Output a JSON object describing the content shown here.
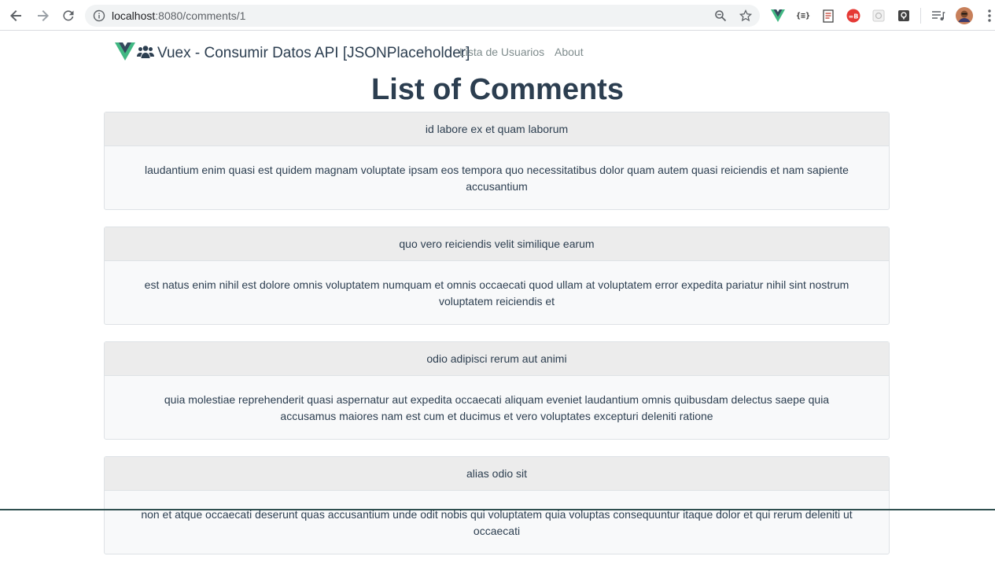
{
  "browser": {
    "url_host": "localhost",
    "url_rest": ":8080/comments/1"
  },
  "app": {
    "brand": "Vuex - Consumir Datos API [JSONPlaceholder]",
    "nav_links": [
      "Lista de Usuarios",
      "About"
    ],
    "title": "List of Comments"
  },
  "comments": [
    {
      "name": "id labore ex et quam laborum",
      "body": "laudantium enim quasi est quidem magnam voluptate ipsam eos tempora quo necessitatibus dolor quam autem quasi reiciendis et nam sapiente accusantium"
    },
    {
      "name": "quo vero reiciendis velit similique earum",
      "body": "est natus enim nihil est dolore omnis voluptatem numquam et omnis occaecati quod ullam at voluptatem error expedita pariatur nihil sint nostrum voluptatem reiciendis et"
    },
    {
      "name": "odio adipisci rerum aut animi",
      "body": "quia molestiae reprehenderit quasi aspernatur aut expedita occaecati aliquam eveniet laudantium omnis quibusdam delectus saepe quia accusamus maiores nam est cum et ducimus et vero voluptates excepturi deleniti ratione"
    },
    {
      "name": "alias odio sit",
      "body": "non et atque occaecati deserunt quas accusantium unde odit nobis qui voluptatem quia voluptas consequuntur itaque dolor et qui rerum deleniti ut occaecati"
    }
  ],
  "colors": {
    "vue_green": "#41b883",
    "vue_dark": "#35495e",
    "text": "#2c3e50"
  }
}
